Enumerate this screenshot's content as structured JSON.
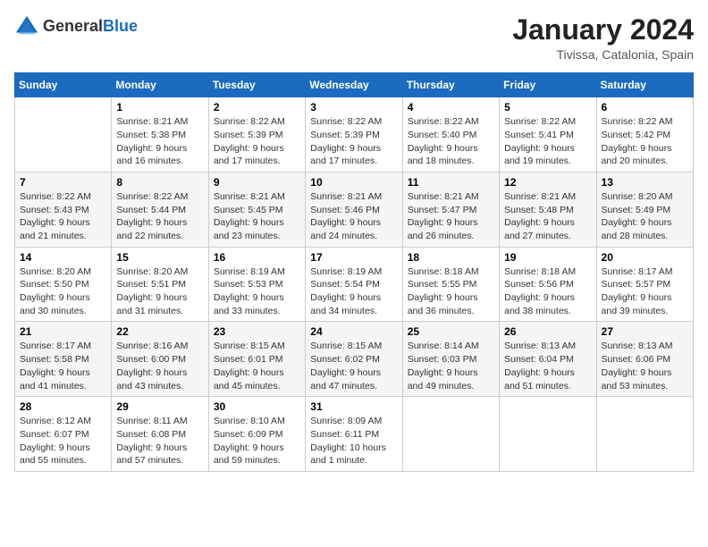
{
  "logo": {
    "general": "General",
    "blue": "Blue"
  },
  "title": "January 2024",
  "location": "Tivissa, Catalonia, Spain",
  "days_of_week": [
    "Sunday",
    "Monday",
    "Tuesday",
    "Wednesday",
    "Thursday",
    "Friday",
    "Saturday"
  ],
  "weeks": [
    [
      {
        "day": "",
        "content": ""
      },
      {
        "day": "1",
        "content": "Sunrise: 8:21 AM\nSunset: 5:38 PM\nDaylight: 9 hours\nand 16 minutes."
      },
      {
        "day": "2",
        "content": "Sunrise: 8:22 AM\nSunset: 5:39 PM\nDaylight: 9 hours\nand 17 minutes."
      },
      {
        "day": "3",
        "content": "Sunrise: 8:22 AM\nSunset: 5:39 PM\nDaylight: 9 hours\nand 17 minutes."
      },
      {
        "day": "4",
        "content": "Sunrise: 8:22 AM\nSunset: 5:40 PM\nDaylight: 9 hours\nand 18 minutes."
      },
      {
        "day": "5",
        "content": "Sunrise: 8:22 AM\nSunset: 5:41 PM\nDaylight: 9 hours\nand 19 minutes."
      },
      {
        "day": "6",
        "content": "Sunrise: 8:22 AM\nSunset: 5:42 PM\nDaylight: 9 hours\nand 20 minutes."
      }
    ],
    [
      {
        "day": "7",
        "content": "Sunrise: 8:22 AM\nSunset: 5:43 PM\nDaylight: 9 hours\nand 21 minutes."
      },
      {
        "day": "8",
        "content": "Sunrise: 8:22 AM\nSunset: 5:44 PM\nDaylight: 9 hours\nand 22 minutes."
      },
      {
        "day": "9",
        "content": "Sunrise: 8:21 AM\nSunset: 5:45 PM\nDaylight: 9 hours\nand 23 minutes."
      },
      {
        "day": "10",
        "content": "Sunrise: 8:21 AM\nSunset: 5:46 PM\nDaylight: 9 hours\nand 24 minutes."
      },
      {
        "day": "11",
        "content": "Sunrise: 8:21 AM\nSunset: 5:47 PM\nDaylight: 9 hours\nand 26 minutes."
      },
      {
        "day": "12",
        "content": "Sunrise: 8:21 AM\nSunset: 5:48 PM\nDaylight: 9 hours\nand 27 minutes."
      },
      {
        "day": "13",
        "content": "Sunrise: 8:20 AM\nSunset: 5:49 PM\nDaylight: 9 hours\nand 28 minutes."
      }
    ],
    [
      {
        "day": "14",
        "content": "Sunrise: 8:20 AM\nSunset: 5:50 PM\nDaylight: 9 hours\nand 30 minutes."
      },
      {
        "day": "15",
        "content": "Sunrise: 8:20 AM\nSunset: 5:51 PM\nDaylight: 9 hours\nand 31 minutes."
      },
      {
        "day": "16",
        "content": "Sunrise: 8:19 AM\nSunset: 5:53 PM\nDaylight: 9 hours\nand 33 minutes."
      },
      {
        "day": "17",
        "content": "Sunrise: 8:19 AM\nSunset: 5:54 PM\nDaylight: 9 hours\nand 34 minutes."
      },
      {
        "day": "18",
        "content": "Sunrise: 8:18 AM\nSunset: 5:55 PM\nDaylight: 9 hours\nand 36 minutes."
      },
      {
        "day": "19",
        "content": "Sunrise: 8:18 AM\nSunset: 5:56 PM\nDaylight: 9 hours\nand 38 minutes."
      },
      {
        "day": "20",
        "content": "Sunrise: 8:17 AM\nSunset: 5:57 PM\nDaylight: 9 hours\nand 39 minutes."
      }
    ],
    [
      {
        "day": "21",
        "content": "Sunrise: 8:17 AM\nSunset: 5:58 PM\nDaylight: 9 hours\nand 41 minutes."
      },
      {
        "day": "22",
        "content": "Sunrise: 8:16 AM\nSunset: 6:00 PM\nDaylight: 9 hours\nand 43 minutes."
      },
      {
        "day": "23",
        "content": "Sunrise: 8:15 AM\nSunset: 6:01 PM\nDaylight: 9 hours\nand 45 minutes."
      },
      {
        "day": "24",
        "content": "Sunrise: 8:15 AM\nSunset: 6:02 PM\nDaylight: 9 hours\nand 47 minutes."
      },
      {
        "day": "25",
        "content": "Sunrise: 8:14 AM\nSunset: 6:03 PM\nDaylight: 9 hours\nand 49 minutes."
      },
      {
        "day": "26",
        "content": "Sunrise: 8:13 AM\nSunset: 6:04 PM\nDaylight: 9 hours\nand 51 minutes."
      },
      {
        "day": "27",
        "content": "Sunrise: 8:13 AM\nSunset: 6:06 PM\nDaylight: 9 hours\nand 53 minutes."
      }
    ],
    [
      {
        "day": "28",
        "content": "Sunrise: 8:12 AM\nSunset: 6:07 PM\nDaylight: 9 hours\nand 55 minutes."
      },
      {
        "day": "29",
        "content": "Sunrise: 8:11 AM\nSunset: 6:08 PM\nDaylight: 9 hours\nand 57 minutes."
      },
      {
        "day": "30",
        "content": "Sunrise: 8:10 AM\nSunset: 6:09 PM\nDaylight: 9 hours\nand 59 minutes."
      },
      {
        "day": "31",
        "content": "Sunrise: 8:09 AM\nSunset: 6:11 PM\nDaylight: 10 hours\nand 1 minute."
      },
      {
        "day": "",
        "content": ""
      },
      {
        "day": "",
        "content": ""
      },
      {
        "day": "",
        "content": ""
      }
    ]
  ]
}
